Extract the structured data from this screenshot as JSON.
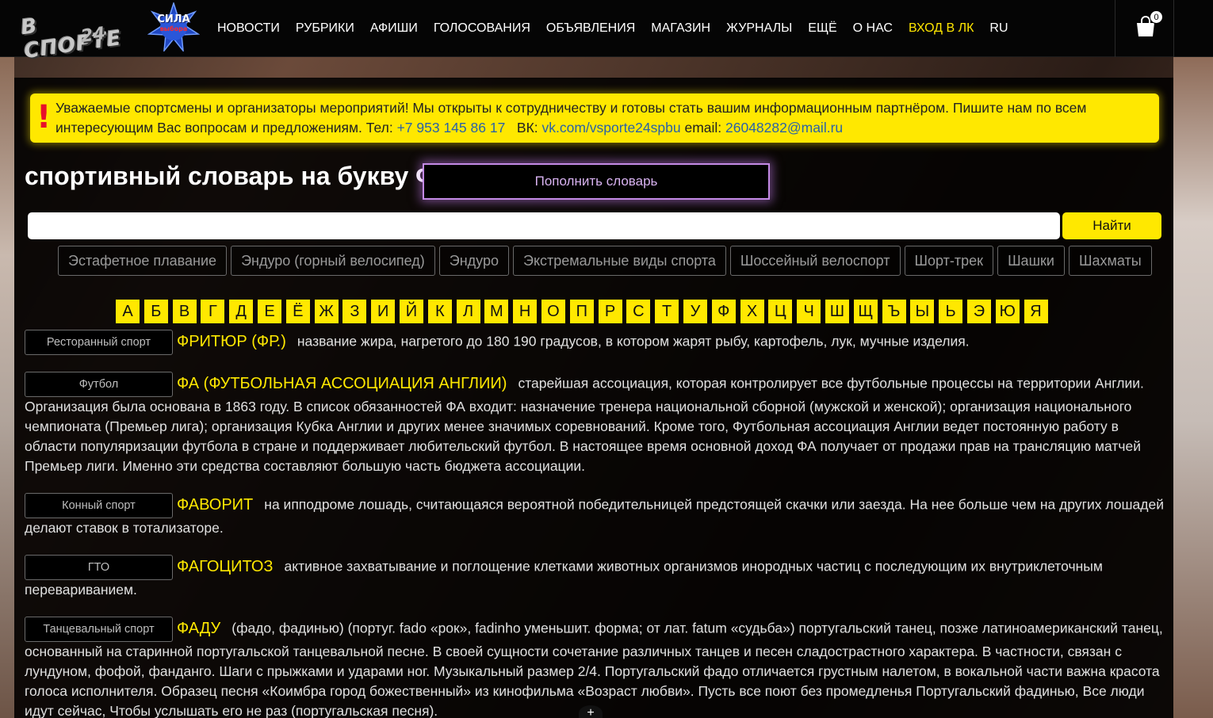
{
  "header": {
    "logo_line1": "В СПОРТЕ",
    "logo_line2": "24",
    "badge_top": "СИЛА",
    "badge_bottom": "выбора",
    "nav": [
      "НОВОСТИ",
      "РУБРИКИ",
      "АФИШИ",
      "ГОЛОСОВАНИЯ",
      "ОБЪЯВЛЕНИЯ",
      "МАГАЗИН",
      "ЖУРНАЛЫ",
      "ЕЩЁ",
      "О НАС"
    ],
    "login": "ВХОД В ЛК",
    "lang": "RU",
    "cart_count": "0"
  },
  "notice": {
    "text1": "Уважаемые спортсмены и организаторы мероприятий! Мы открыты к сотрудничеству и готовы стать вашим информационным партнёром. Пишите нам по всем интересующим Вас вопросам и предложениям. Тел: ",
    "phone": "+7 953 145 86 17",
    "vk_label": "   ВК: ",
    "vk": "vk.com/vsporte24spbu",
    "email_label": " email: ",
    "email": "26048282@mail.ru"
  },
  "page_title": "спортивный словарь на букву Ф",
  "add_button": "Пополнить словарь",
  "search": {
    "placeholder": "",
    "button": "Найти"
  },
  "tags": [
    "Эстафетное плавание",
    "Эндуро (горный велосипед)",
    "Эндуро",
    "Экстремальные виды спорта",
    "Шоссейный велоспорт",
    "Шорт-трек",
    "Шашки",
    "Шахматы"
  ],
  "alphabet": [
    "А",
    "Б",
    "В",
    "Г",
    "Д",
    "Е",
    "Ё",
    "Ж",
    "З",
    "И",
    "Й",
    "К",
    "Л",
    "М",
    "Н",
    "О",
    "П",
    "Р",
    "С",
    "Т",
    "У",
    "Ф",
    "Х",
    "Ц",
    "Ч",
    "Ш",
    "Щ",
    "Ъ",
    "Ы",
    "Ь",
    "Э",
    "Ю",
    "Я"
  ],
  "entries": [
    {
      "category": "Ресторанный спорт",
      "term": "ФРИТЮР (ФР.)",
      "text": "название жира, нагретого до 180 190 градусов, в котором жарят рыбу, картофель, лук, мучные изделия."
    },
    {
      "category": "Футбол",
      "term": "ФА (ФУТБОЛЬНАЯ АССОЦИАЦИЯ АНГЛИИ)",
      "text": "старейшая ассоциация, которая контролирует все футбольные процессы на территории Англии. Организация была основана в 1863 году. В список обязанностей ФА входит: назначение тренера национальной сборной (мужской и женской); организация национального чемпионата (Премьер лига); организация Кубка Англии и других менее значимых соревнований. Кроме того, Футбольная ассоциация Англии ведет постоянную работу в области популяризации футбола в стране и поддерживает любительский футбол. В настоящее время основной доход ФА получает от продажи прав на трансляцию матчей Премьер лиги. Именно эти средства составляют большую часть бюджета ассоциации."
    },
    {
      "category": "Конный спорт",
      "term": "ФАВОРИТ",
      "text": "на ипподроме лошадь, считающаяся вероятной победительницей предстоящей скачки или заезда. На нее больше чем на других лошадей делают ставок в тотализаторе."
    },
    {
      "category": "ГТО",
      "term": "ФАГОЦИТОЗ",
      "text": "активное захватывание и поглощение клетками животных организмов инородных частиц с последующим их внутриклеточным перевариванием."
    },
    {
      "category": "Танцевальный спорт",
      "term": "ФАДУ",
      "text": "(фадо, фадинью) (португ. fado «рок», fadinho уменьшит. форма; от лат. fatum «судьба») португальский танец, позже латиноамериканский танец, основанный на старинной португальской танцевальной песне. В своей сущности сочетание различных танцев и песен сладострастного характера. В частности, связан с лундуном, фофой, фанданго. Шаги с прыжками и ударами ног. Музыкальный размер 2/4. Португальский фадо отличается грустным налетом, в вокальной части важна красота голоса исполнителя. Образец песня «Коимбра город божественный» из кинофильма «Возраст любви». Пусть все поют без промедленья Португальский фадинью, Все люди идут сейчас, Чтобы услышать его не раз (португальская песня)."
    }
  ],
  "colors": {
    "accent": "#ffe800",
    "alert": "#e8102a",
    "link": "#2a62a8",
    "glow": "#c48ae6"
  }
}
